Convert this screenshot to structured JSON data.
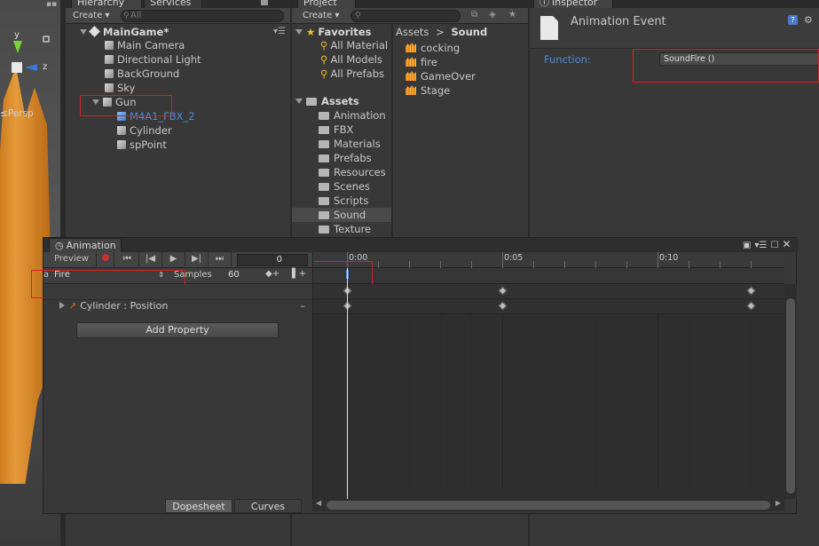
{
  "scene": {
    "persp_label": "≤Persp",
    "axis_y": "y",
    "axis_z": "z"
  },
  "hierarchy": {
    "tab": "Hierarchy",
    "tab2": "Services",
    "create": "Create ▾",
    "search_placeholder": "All",
    "root": "MainGame*",
    "items": [
      "Main Camera",
      "Directional Light",
      "BackGround",
      "Sky",
      "Gun",
      "M4A1_FBX_2",
      "Cylinder",
      "spPoint"
    ]
  },
  "project": {
    "tab": "Project",
    "create": "Create ▾",
    "favorites_label": "Favorites",
    "favorites": [
      "All Material",
      "All Models",
      "All Prefabs"
    ],
    "assets_label": "Assets",
    "folders": [
      "Animation",
      "FBX",
      "Materials",
      "Prefabs",
      "Resources",
      "Scenes",
      "Scripts",
      "Sound",
      "Texture"
    ],
    "breadcrumb_root": "Assets",
    "breadcrumb_sep": ">",
    "breadcrumb_current": "Sound",
    "sounds": [
      "cocking",
      "fire",
      "GameOver",
      "Stage"
    ]
  },
  "inspector": {
    "tab": "Inspector",
    "title": "Animation Event",
    "function_label": "Function:",
    "function_value": "SoundFire ()"
  },
  "animation": {
    "tab": "Animation",
    "preview": "Preview",
    "frame": "0",
    "clip": "Fire",
    "samples_label": "Samples",
    "samples_value": "60",
    "property": "Cylinder : Position",
    "add_property": "Add Property",
    "dopesheet": "Dopesheet",
    "curves": "Curves",
    "ruler": [
      "0:00",
      "0:05",
      "0:10"
    ],
    "prefix_label": "a"
  },
  "colors": {
    "accent_blue": "#4a8fd8",
    "selection": "#3e5f96",
    "record_red": "#c83030",
    "highlight": "#d42020"
  }
}
